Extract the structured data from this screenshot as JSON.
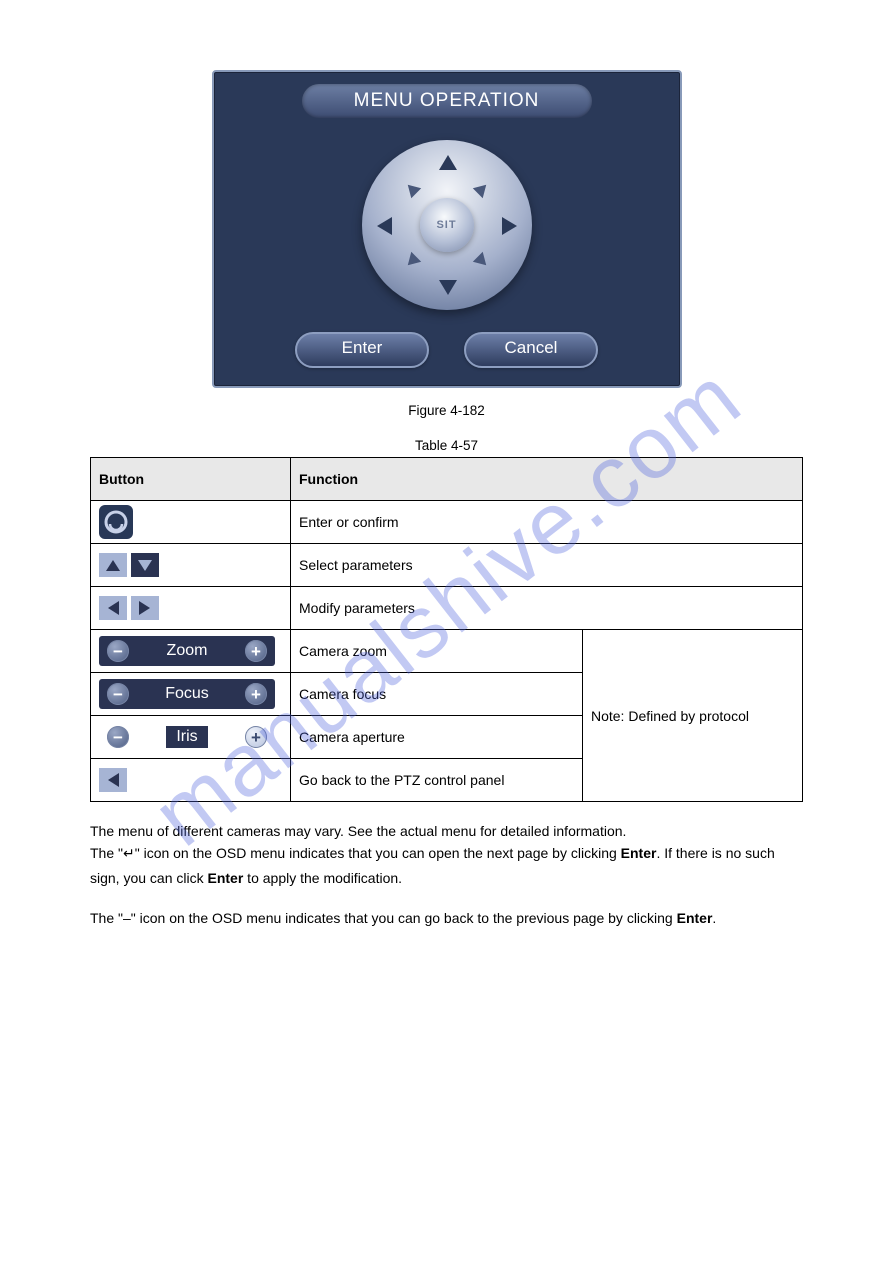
{
  "dialog": {
    "title": "MENU OPERATION",
    "center": "SIT",
    "enter": "Enter",
    "cancel": "Cancel",
    "caption": "Figure 4-182"
  },
  "table": {
    "caption": "Table 4-57",
    "head_button": "Button",
    "head_function": "Function",
    "row_sit_fn": "Enter or confirm",
    "row_updown_fn": "Select parameters",
    "row_leftright_fn": "Modify parameters",
    "row_zoom": "Zoom",
    "row_zoom_fn": "Camera zoom",
    "row_focus": "Focus",
    "row_focus_fn": "Camera focus",
    "row_iris": "Iris",
    "row_iris_fn": "Camera aperture",
    "row_return_fn": "Go back to the PTZ control panel",
    "note_col": "Note: Defined by protocol"
  },
  "body": {
    "p1_a": "The menu of different cameras may vary. See the actual menu for detailed information.",
    "p1_b_1": "The \"",
    "p1_b_2": "\" icon on the OSD menu indicates that you can open the next page by clicking ",
    "p1_b_3": "Enter",
    "p1_b_4": ". If there is no such sign, you can click ",
    "p1_b_5": "Enter",
    "p1_b_6": " to apply the modification.",
    "p2_a": "The \"–\" icon on the OSD menu indicates that you can go back to the previous page by clicking ",
    "p2_b": "Enter",
    "p2_c": "."
  },
  "watermark": "manualshive.com"
}
